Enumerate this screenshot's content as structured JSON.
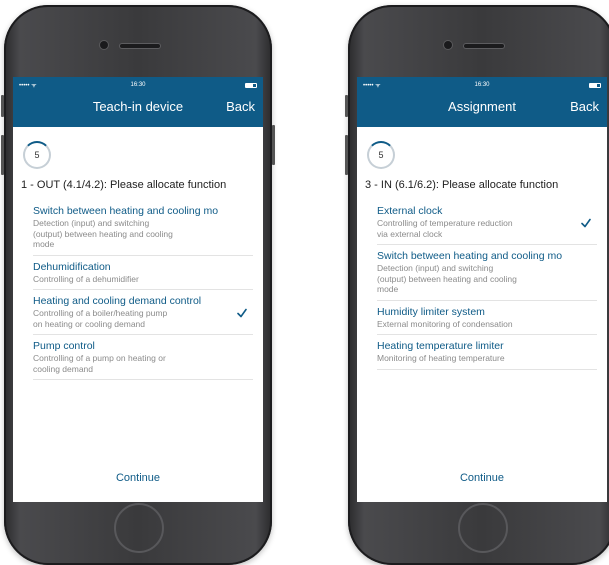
{
  "phones": [
    {
      "status": {
        "signal": "••••• ᯤ",
        "time": "16:30"
      },
      "nav": {
        "title": "Teach-in device",
        "back": "Back"
      },
      "step": "5",
      "prompt": "1 - OUT (4.1/4.2): Please allocate function",
      "items": [
        {
          "title": "Switch between heating and cooling mo",
          "desc": "Detection (input) and switching (output) between heating and cooling mode",
          "checked": false
        },
        {
          "title": "Dehumidification",
          "desc": "Controlling of a dehumidifier",
          "checked": false
        },
        {
          "title": "Heating and cooling demand control",
          "desc": "Controlling of a boiler/heating pump on heating or cooling demand",
          "checked": true
        },
        {
          "title": "Pump control",
          "desc": "Controlling of a pump on heating or cooling demand",
          "checked": false
        }
      ],
      "continue": "Continue"
    },
    {
      "status": {
        "signal": "••••• ᯤ",
        "time": "16:30"
      },
      "nav": {
        "title": "Assignment",
        "back": "Back"
      },
      "step": "5",
      "prompt": "3 - IN (6.1/6.2): Please allocate function",
      "items": [
        {
          "title": "External clock",
          "desc": "Controlling of temperature reduction via external clock",
          "checked": true
        },
        {
          "title": "Switch between heating and cooling mo",
          "desc": "Detection (input) and switching (output) between heating and cooling mode",
          "checked": false
        },
        {
          "title": "Humidity limiter system",
          "desc": "External monitoring of condensation",
          "checked": false
        },
        {
          "title": "Heating temperature limiter",
          "desc": "Monitoring of heating temperature",
          "checked": false
        }
      ],
      "continue": "Continue"
    }
  ],
  "colors": {
    "accent": "#0f5b87",
    "description": "#8b8b8b",
    "divider": "#e3e3e3"
  },
  "icons": {
    "check": "check-icon"
  }
}
